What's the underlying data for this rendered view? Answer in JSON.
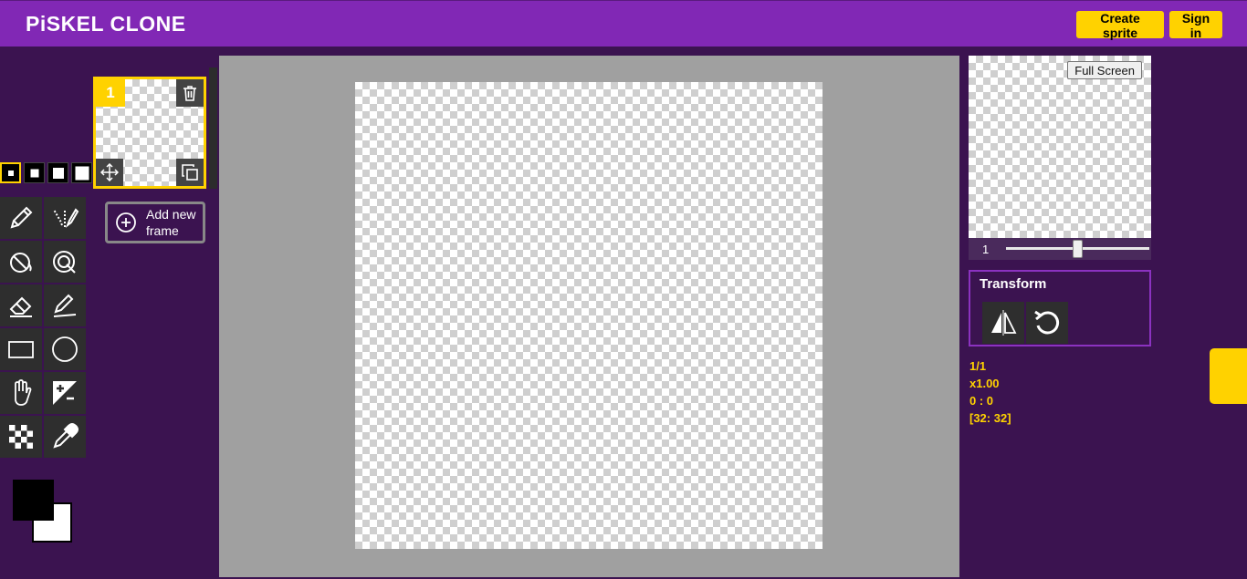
{
  "header": {
    "logo": "PiSKEL CLONE",
    "create_sprite_label": "Create sprite",
    "sign_in_label": "Sign in"
  },
  "colors": {
    "header_bg": "#8128b5",
    "page_bg": "#3b1350",
    "accent": "#ffd200",
    "primary_color": "#000000",
    "secondary_color": "#ffffff"
  },
  "pen_sizes": {
    "count": 4,
    "selected_index": 0
  },
  "tools": [
    {
      "name": "pen-tool",
      "icon": "pencil-icon"
    },
    {
      "name": "vertical-mirror-pen-tool",
      "icon": "mirror-pen-icon"
    },
    {
      "name": "paint-bucket-tool",
      "icon": "paint-bucket-icon"
    },
    {
      "name": "paint-all-same-color-tool",
      "icon": "magic-bucket-icon"
    },
    {
      "name": "eraser-tool",
      "icon": "eraser-icon"
    },
    {
      "name": "stroke-tool",
      "icon": "stroke-line-icon"
    },
    {
      "name": "rectangle-tool",
      "icon": "rectangle-icon"
    },
    {
      "name": "circle-tool",
      "icon": "circle-icon"
    },
    {
      "name": "move-tool",
      "icon": "hand-icon"
    },
    {
      "name": "lighten-tool",
      "icon": "lighten-darken-icon"
    },
    {
      "name": "dithering-tool",
      "icon": "checker-icon"
    },
    {
      "name": "color-picker-tool",
      "icon": "eyedropper-icon"
    }
  ],
  "frames": {
    "items": [
      {
        "number": "1",
        "selected": true
      }
    ],
    "add_label": "Add new frame"
  },
  "preview": {
    "fullscreen_label": "Full Screen",
    "fps": "1",
    "fps_fraction": 0.5
  },
  "transform": {
    "title": "Transform",
    "tools": [
      "flip-icon",
      "rotate-icon"
    ]
  },
  "cursor_info": {
    "frame": "1/1",
    "zoom": "x1.00",
    "coords": "0 : 0",
    "size": "[32: 32]"
  }
}
